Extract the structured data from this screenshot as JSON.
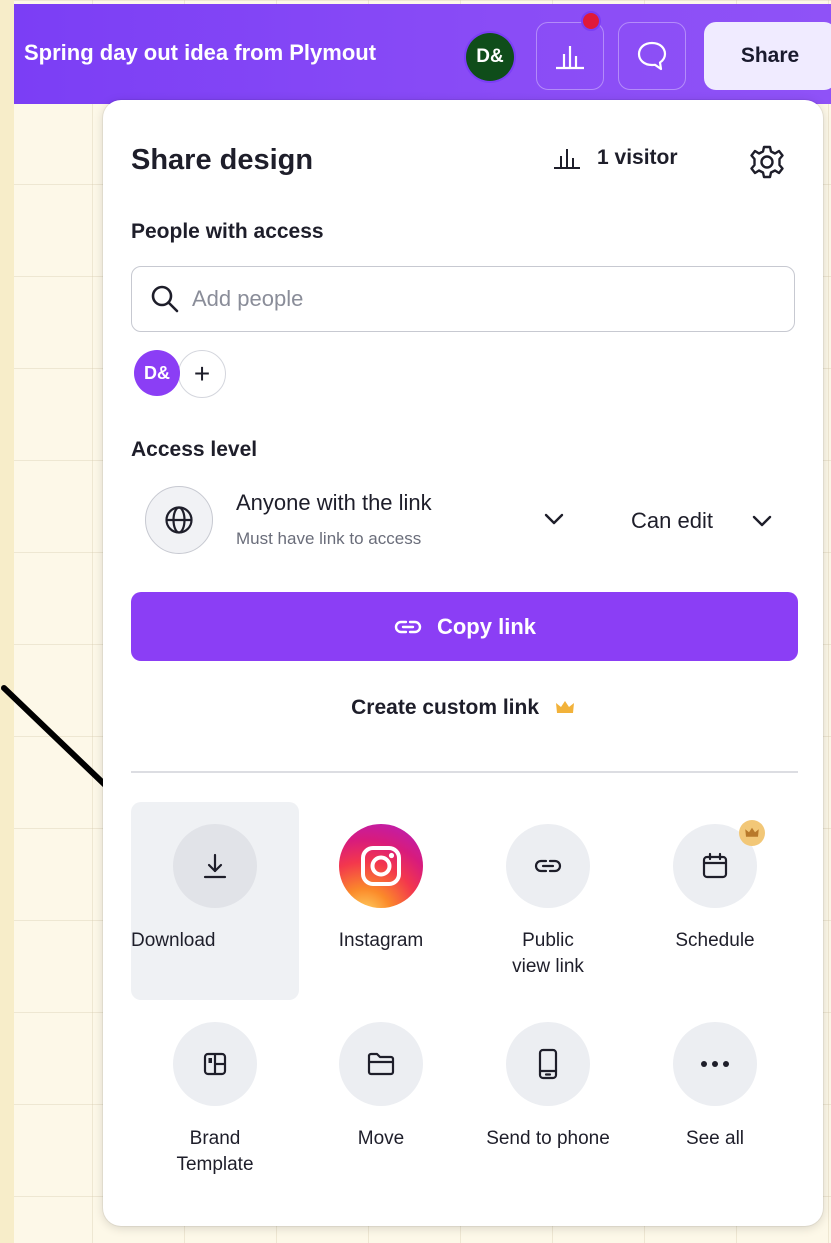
{
  "header": {
    "doc_title": "Spring day out idea from Plymout",
    "avatar_initials": "D&",
    "share_label": "Share",
    "accent_color": "#7b3ef5",
    "notification_color": "#e0193a"
  },
  "panel": {
    "title": "Share design",
    "visitor_count": "1 visitor",
    "people_with_access_label": "People with access",
    "search_placeholder": "Add people",
    "owner_initials": "D&",
    "add_person_symbol": "+",
    "access_level_label": "Access level",
    "access_main": "Anyone with the link",
    "access_sub": "Must have link to access",
    "permission": "Can edit",
    "copy_link_label": "Copy link",
    "custom_link_label": "Create custom link",
    "share_options": [
      {
        "label": "Download",
        "icon": "download-icon"
      },
      {
        "label": "Instagram",
        "icon": "instagram-icon"
      },
      {
        "label": "Public\nview link",
        "icon": "link-icon"
      },
      {
        "label": "Schedule",
        "icon": "calendar-icon"
      },
      {
        "label": "Brand\nTemplate",
        "icon": "brand-template-icon"
      },
      {
        "label": "Move",
        "icon": "folder-icon"
      },
      {
        "label": "Send to phone",
        "icon": "phone-icon"
      },
      {
        "label": "See all",
        "icon": "more-icon"
      }
    ]
  }
}
